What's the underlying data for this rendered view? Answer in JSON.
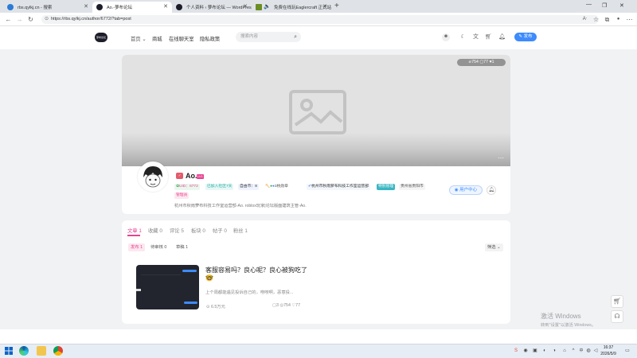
{
  "browser": {
    "tabs": [
      {
        "title": "rbs.qylkj.cn - 搜索",
        "active": false
      },
      {
        "title": "Ao.-萝布论坛",
        "active": true
      },
      {
        "title": "个人资料 ‹ 萝布论坛 — WordPress",
        "active": false
      },
      {
        "title": "免费在线玩Eaglercraft 正式站",
        "active": false
      }
    ],
    "new_tab": "+",
    "url": "https://rbs.qylkj.cn/author/6772/?tab=post",
    "window_controls": [
      "—",
      "❐",
      "✕"
    ]
  },
  "site": {
    "logo_text": "萝布论坛",
    "nav": [
      "首页",
      "商城",
      "在线聊天室",
      "隐私政策"
    ],
    "search_placeholder": "搜索内容",
    "publish_label": "发布"
  },
  "profile": {
    "cover_stats": {
      "views": "754",
      "comments": "77",
      "likes": "1"
    },
    "username": "Ao.",
    "level_badge": "LV1",
    "tags": {
      "uid": "UID：6772",
      "joined": "已加入社区7天",
      "points": "自由币：8",
      "medals": "3枚勋章",
      "verified": "杭州市秋雨萝布科技工作室运营部",
      "role_badge": "特别管理",
      "location": "贵州省贵阳市",
      "gender": "管理员"
    },
    "bio": "杭州市秋雨萝布科技工作室运营部-Ao. roblox玩家|论坛版面建筑主管-Ao.",
    "user_center_label": "用户中心"
  },
  "content_tabs": [
    {
      "label": "文章",
      "count": "1",
      "active": true
    },
    {
      "label": "收藏",
      "count": "0",
      "active": false
    },
    {
      "label": "评论",
      "count": "5",
      "active": false
    },
    {
      "label": "板块",
      "count": "0",
      "active": false
    },
    {
      "label": "帖子",
      "count": "0",
      "active": false
    },
    {
      "label": "粉丝",
      "count": "1",
      "active": false
    }
  ],
  "sub_tabs": [
    {
      "label": "发布 1",
      "active": true
    },
    {
      "label": "待审核 0",
      "active": false
    },
    {
      "label": "草稿 1",
      "active": false
    }
  ],
  "sort_label": "筛选",
  "post": {
    "title": "客服容易吗？良心呢？良心被狗吃了",
    "emoji": "🤓",
    "excerpt": "上个周都能遇见投诉自己的，唠唠啊，恶意投...",
    "price_tag": "6.5万元",
    "comments": "3",
    "views": "754",
    "likes": "77"
  },
  "watermark": {
    "line1": "激活 Windows",
    "line2": "转到\"设置\"以激活 Windows。"
  },
  "clock": {
    "time": "16:37",
    "date": "2026/5/9"
  },
  "colors": {
    "accent": "#e84393",
    "publish": "#3d8bfd",
    "uid_green": "#2ea44f"
  }
}
